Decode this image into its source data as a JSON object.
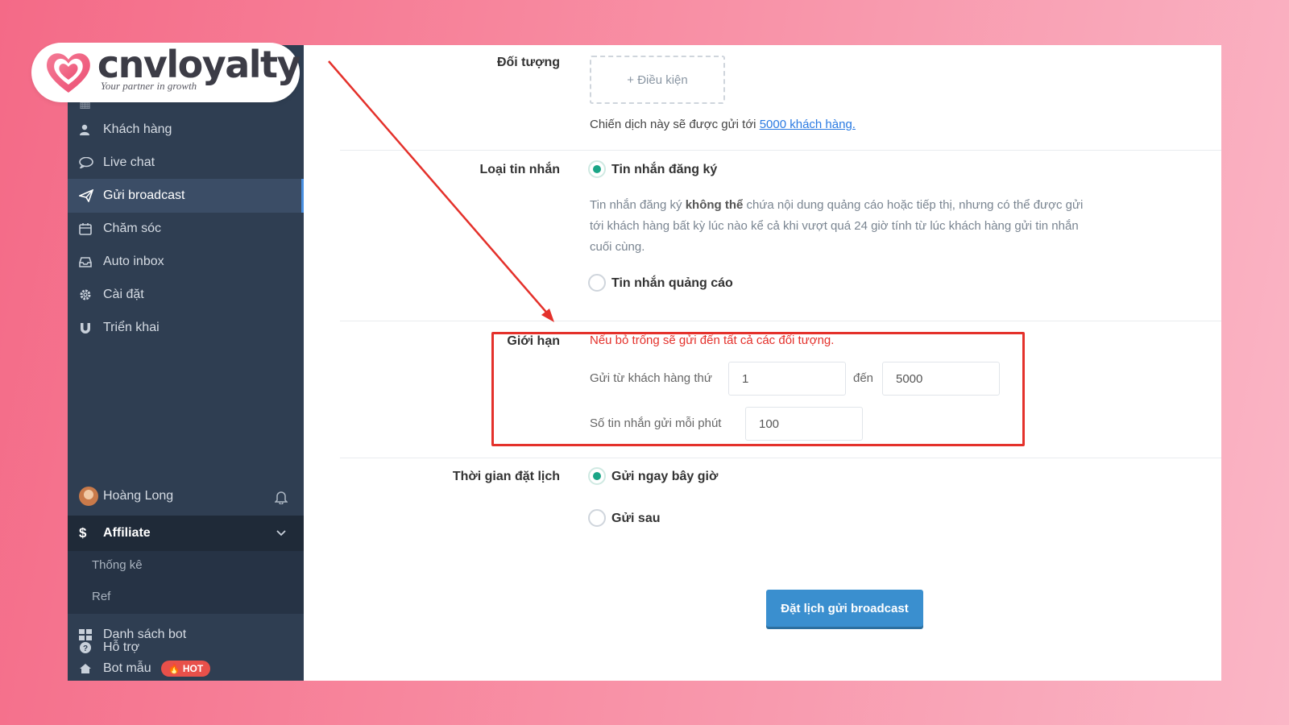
{
  "brand": {
    "name": "cnvloyalty",
    "tagline": "Your partner in growth",
    "accent": "#f46a87"
  },
  "sidebar": {
    "items": [
      {
        "label": "Khách hàng",
        "icon": "user-icon"
      },
      {
        "label": "Live chat",
        "icon": "chat-bubble-icon"
      },
      {
        "label": "Gửi broadcast",
        "icon": "paper-plane-icon",
        "active": true
      },
      {
        "label": "Chăm sóc",
        "icon": "calendar-icon"
      },
      {
        "label": "Auto inbox",
        "icon": "inbox-icon"
      },
      {
        "label": "Cài đặt",
        "icon": "gear-icon"
      },
      {
        "label": "Triển khai",
        "icon": "magnet-icon"
      }
    ],
    "user": {
      "name": "Hoàng Long",
      "notification_icon": "bell-icon"
    },
    "affiliate": {
      "label": "Affiliate",
      "icon": "dollar-icon",
      "sub_items": [
        "Thống kê",
        "Ref"
      ]
    },
    "bottom_items": [
      {
        "label": "Danh sách bot",
        "icon": "grid-icon"
      },
      {
        "label": "Bot mẫu",
        "icon": "home-icon",
        "badge": "HOT"
      },
      {
        "label": "Hỗ trợ",
        "icon": "question-circle-icon"
      }
    ],
    "bg_color": "#2f3e52"
  },
  "form": {
    "audience": {
      "label": "Đối tượng",
      "condition_button": "+ Điều kiện",
      "summary_prefix": "Chiến dịch này sẽ được gửi tới",
      "summary_link": "5000 khách hàng."
    },
    "message_type": {
      "label": "Loại tin nhắn",
      "options": [
        {
          "label": "Tin nhắn đăng ký",
          "checked": true
        },
        {
          "label": "Tin nhắn quảng cáo",
          "checked": false
        }
      ],
      "desc_part1": "Tin nhắn đăng ký ",
      "desc_bold": "không thể",
      "desc_part2": " chứa nội dung quảng cáo hoặc tiếp thị, nhưng có thể được gửi tới khách hàng bất kỳ lúc nào kể cả khi vượt quá 24 giờ tính từ lúc khách hàng gửi tin nhắn cuối cùng."
    },
    "limit": {
      "label": "Giới hạn",
      "warning": "Nếu bỏ trống sẽ gửi đến tất cả các đối tượng.",
      "from_label": "Gửi từ khách hàng thứ",
      "from_value": "1",
      "to_label": "đến",
      "to_value": "5000",
      "rate_label": "Số tin nhắn gửi mỗi phút",
      "rate_value": "100"
    },
    "schedule": {
      "label": "Thời gian đặt lịch",
      "options": [
        {
          "label": "Gửi ngay bây giờ",
          "checked": true
        },
        {
          "label": "Gửi sau",
          "checked": false
        }
      ]
    },
    "submit_label": "Đặt lịch gửi broadcast",
    "highlight_color": "#e4312b",
    "radio_color": "#1aa586",
    "button_color": "#3a8fcf"
  }
}
